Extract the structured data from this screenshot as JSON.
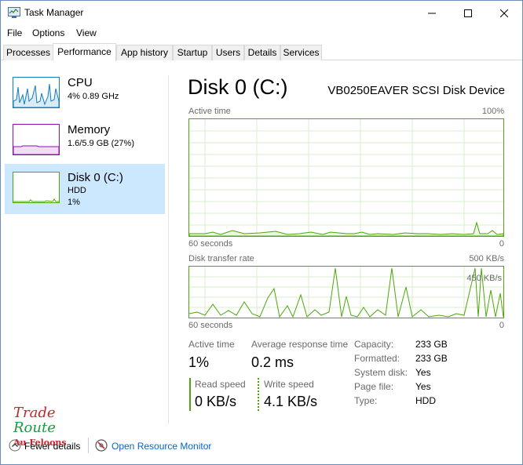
{
  "window": {
    "title": "Task Manager",
    "controls": {
      "minimize": "minimize-icon",
      "maximize": "maximize-icon",
      "close": "close-icon"
    }
  },
  "menu": [
    "File",
    "Options",
    "View"
  ],
  "tabs": [
    "Processes",
    "Performance",
    "App history",
    "Startup",
    "Users",
    "Details",
    "Services"
  ],
  "active_tab": "Performance",
  "sidebar": {
    "items": [
      {
        "title": "CPU",
        "line1": "4% 0.89 GHz",
        "line2": ""
      },
      {
        "title": "Memory",
        "line1": "1.6/5.9 GB (27%)",
        "line2": ""
      },
      {
        "title": "Disk 0 (C:)",
        "line1": "HDD",
        "line2": "1%"
      }
    ],
    "selected": "Disk 0 (C:)"
  },
  "main": {
    "title": "Disk 0 (C:)",
    "device": "VB0250EAVER SCSI Disk Device",
    "graph1": {
      "label": "Active time",
      "max": "100%",
      "xlabel": "60 seconds",
      "xmin": "0"
    },
    "graph2": {
      "label": "Disk transfer rate",
      "max": "500 KB/s",
      "mid": "450 KB/s",
      "xlabel": "60 seconds",
      "xmin": "0"
    },
    "stats": {
      "active_time_label": "Active time",
      "active_time_value": "1%",
      "avg_response_label": "Average response time",
      "avg_response_value": "0.2 ms",
      "read_label": "Read speed",
      "read_value": "0 KB/s",
      "write_label": "Write speed",
      "write_value": "4.1 KB/s"
    },
    "info": [
      {
        "label": "Capacity:",
        "value": "233 GB"
      },
      {
        "label": "Formatted:",
        "value": "233 GB"
      },
      {
        "label": "System disk:",
        "value": "Yes"
      },
      {
        "label": "Page file:",
        "value": "Yes"
      },
      {
        "label": "Type:",
        "value": "HDD"
      }
    ]
  },
  "footer": {
    "fewer_details": "Fewer details",
    "open_resource_monitor": "Open Resource Monitor"
  },
  "watermark": {
    "line1": "Trade",
    "line2": "Route",
    "line3": "Au Feloons"
  },
  "colors": {
    "cpu": "#117dbb",
    "memory": "#8b12ae",
    "disk": "#4da60c",
    "selected_bg": "#cce8ff",
    "link": "#0066cc"
  }
}
